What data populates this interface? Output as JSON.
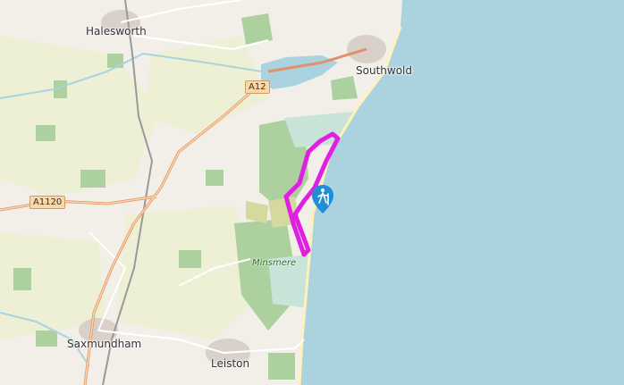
{
  "map": {
    "towns": {
      "halesworth": "Halesworth",
      "southwold": "Southwold",
      "saxmundham": "Saxmundham",
      "leiston": "Leiston"
    },
    "roads": {
      "a12": "A12",
      "a1120": "A1120"
    },
    "areas": {
      "minsmere": "Minsmere"
    },
    "marker": {
      "icon": "hiking-icon",
      "color": "#1f8ed6"
    },
    "route": {
      "color": "#e020e0"
    },
    "colors": {
      "sea": "#aad3df",
      "land": "#f2efe9",
      "forest": "#add19e",
      "farmland": "#eef0d5",
      "heath": "#d6d99f",
      "primary_road": "#fcd6a4"
    }
  }
}
